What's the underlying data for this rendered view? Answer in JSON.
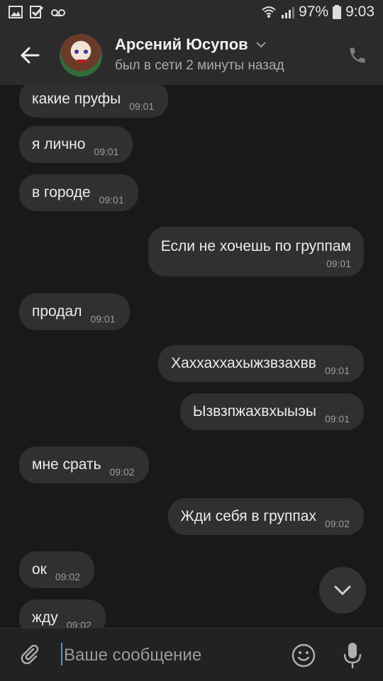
{
  "statusbar": {
    "battery": "97%",
    "time": "9:03",
    "icons": [
      "gallery-icon",
      "check-icon",
      "voicemail-icon",
      "wifi-icon",
      "signal-icon",
      "battery-icon"
    ]
  },
  "header": {
    "name": "Арсений Юсупов",
    "status": "был в сети 2 минуты назад",
    "icons": [
      "back-arrow-icon",
      "chevron-down-icon",
      "phone-icon"
    ]
  },
  "messages": [
    {
      "dir": "in",
      "text": "какие пруфы",
      "time": "09:01"
    },
    {
      "dir": "in",
      "text": "я лично",
      "time": "09:01"
    },
    {
      "dir": "in",
      "text": "в городе",
      "time": "09:01"
    },
    {
      "dir": "out",
      "text": "Если не хочешь по группам",
      "time": "09:01"
    },
    {
      "dir": "in",
      "text": "продал",
      "time": "09:01"
    },
    {
      "dir": "out",
      "text": "Хаххаххахыжзвзахвв",
      "time": "09:01"
    },
    {
      "dir": "out",
      "text": "Ызвзпжахвхыыэы",
      "time": "09:01"
    },
    {
      "dir": "in",
      "text": "мне срать",
      "time": "09:02"
    },
    {
      "dir": "out",
      "text": "Жди себя в группах",
      "time": "09:02"
    },
    {
      "dir": "in",
      "text": "ок",
      "time": "09:02"
    },
    {
      "dir": "in",
      "text": "жду",
      "time": "09:02"
    }
  ],
  "input": {
    "placeholder": "Ваше сообщение",
    "value": "",
    "icons": [
      "attach-icon",
      "emoji-icon",
      "mic-icon"
    ]
  },
  "colors": {
    "background": "#19191a",
    "bar": "#2b2b2c",
    "bubble": "#303030",
    "accent": "#5a8fd6"
  }
}
